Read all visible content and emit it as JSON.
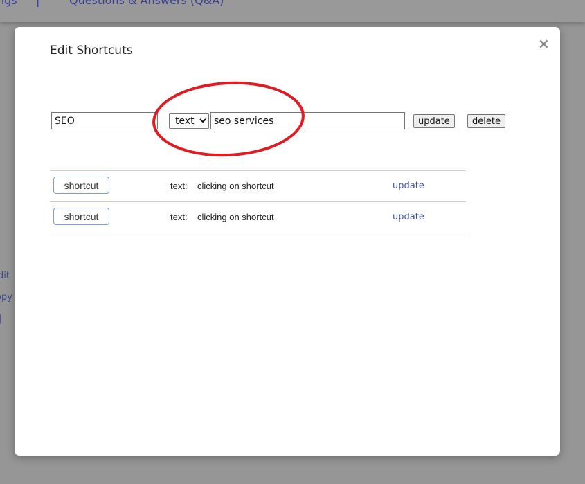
{
  "background": {
    "nav_left": "ngs",
    "nav_separator": "|",
    "nav_qa": "Questions & Answers (Q&A)",
    "side_edit": "dit",
    "side_copy": "opy",
    "side_bar": "|"
  },
  "modal": {
    "title": "Edit Shortcuts",
    "close_icon": "×",
    "form": {
      "name_value": "SEO",
      "type_selected": "text",
      "value": "seo services",
      "update_label": "update",
      "delete_label": "delete"
    },
    "shortcuts": [
      {
        "button": "shortcut",
        "type_label": "text:",
        "text": "clicking on shortcut",
        "action": "update"
      },
      {
        "button": "shortcut",
        "type_label": "text:",
        "text": "clicking on shortcut",
        "action": "update"
      }
    ],
    "annotation_color": "#e01b24"
  }
}
